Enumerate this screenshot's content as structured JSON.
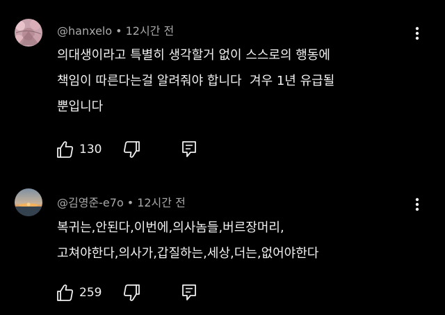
{
  "comments": [
    {
      "author": "@hanxelo",
      "separator": "•",
      "time": "12시간 전",
      "lines": [
        "의대생이라고 특별히 생각할거 없이 스스로의 행동에",
        "책임이 따른다는걸 알려줘야 합니다  겨우 1년 유급될",
        "뿐입니다"
      ],
      "likes": "130",
      "avatar_icon": "cherry-blossom-avatar"
    },
    {
      "author": "@김영준-e7o",
      "separator": "•",
      "time": "12시간 전",
      "lines": [
        "복귀는,안된다,이번에,의사놈들,버르장머리,",
        "고쳐야한다,의사가,갑질하는,세상,더는,없어야한다"
      ],
      "likes": "259",
      "avatar_icon": "sunset-avatar"
    }
  ],
  "icons": {
    "like": "thumbs-up-icon",
    "dislike": "thumbs-down-icon",
    "reply": "reply-icon",
    "more": "more-vert-icon"
  },
  "colors": {
    "background": "#000000",
    "text": "#f1f1f1",
    "secondary": "#aaaaaa"
  }
}
